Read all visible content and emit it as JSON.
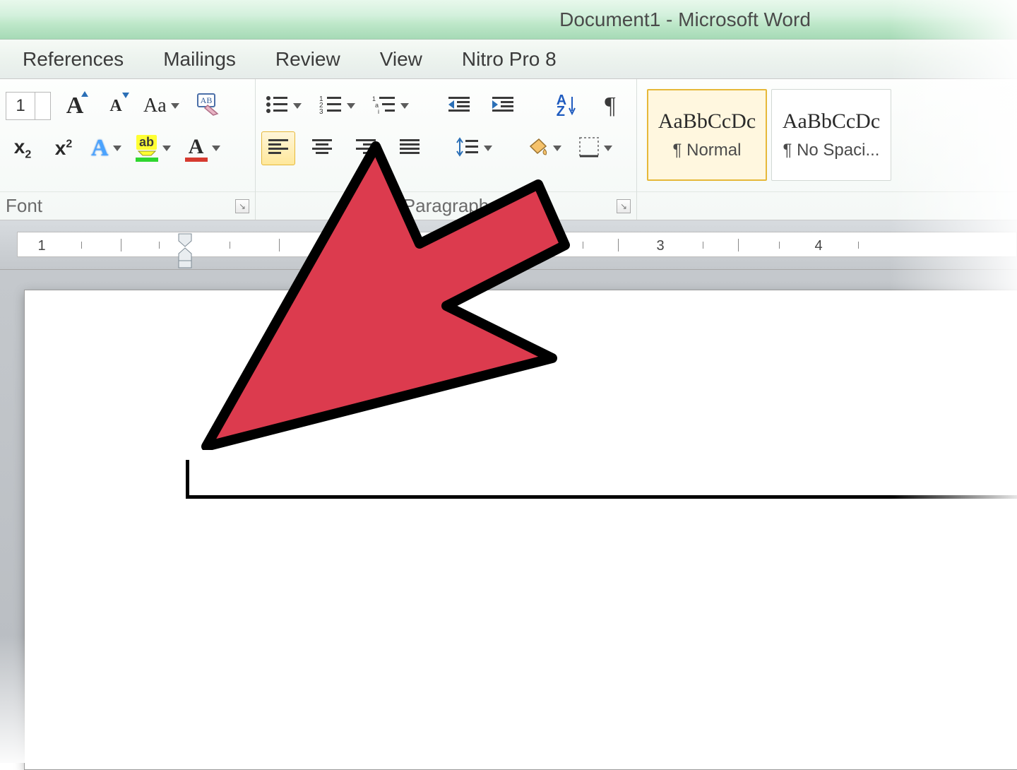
{
  "title": "Document1 - Microsoft Word",
  "tabs": {
    "references": "References",
    "mailings": "Mailings",
    "review": "Review",
    "view": "View",
    "nitro": "Nitro Pro 8"
  },
  "font_group": {
    "label": "Font",
    "size_value": "1",
    "grow_letter": "A",
    "shrink_letter": "A",
    "case_letters": "Aa",
    "subscript": "x",
    "superscript": "x",
    "text_effects": "A",
    "highlight": "ab",
    "font_color_letter": "A"
  },
  "paragraph_group": {
    "label": "Paragraph",
    "sort_letters": "A\nZ"
  },
  "styles_group": {
    "sample_text": "AaBbCcDc",
    "normal": "¶ Normal",
    "no_spacing": "¶ No Spaci..."
  },
  "ruler": {
    "marks": [
      "1",
      "3",
      "4"
    ]
  }
}
